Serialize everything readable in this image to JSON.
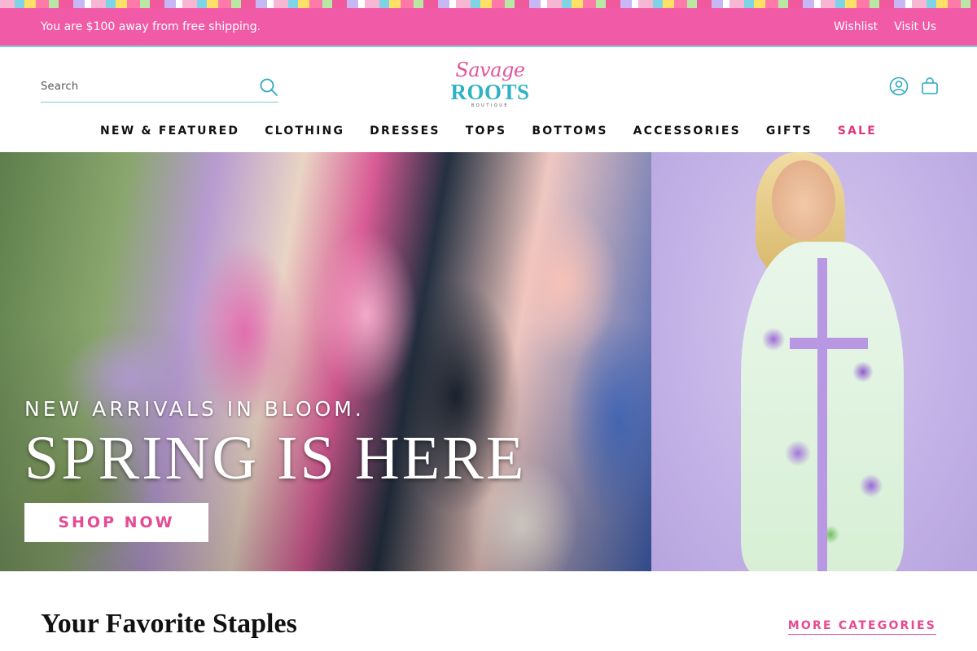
{
  "announcement": {
    "text": "You are $100 away from free shipping.",
    "links": [
      "Wishlist",
      "Visit Us"
    ]
  },
  "header": {
    "search_placeholder": "Search",
    "logo": {
      "script": "Savage",
      "main": "ROOTS",
      "sub": "BOUTIQUE"
    }
  },
  "nav": {
    "items": [
      "NEW & FEATURED",
      "CLOTHING",
      "DRESSES",
      "TOPS",
      "BOTTOMS",
      "ACCESSORIES",
      "GIFTS",
      "SALE"
    ]
  },
  "hero": {
    "kicker": "NEW ARRIVALS IN BLOOM.",
    "title": "SPRING IS HERE",
    "button": "SHOP NOW"
  },
  "section": {
    "title": "Your Favorite Staples",
    "link": "MORE CATEGORIES"
  },
  "colors": {
    "announcement_bg": "#f05aa7",
    "accent_pink": "#e64a92",
    "teal": "#2fb3c4",
    "sale_red": "#e0357f"
  },
  "icons": [
    "search-icon",
    "account-icon",
    "cart-icon"
  ]
}
